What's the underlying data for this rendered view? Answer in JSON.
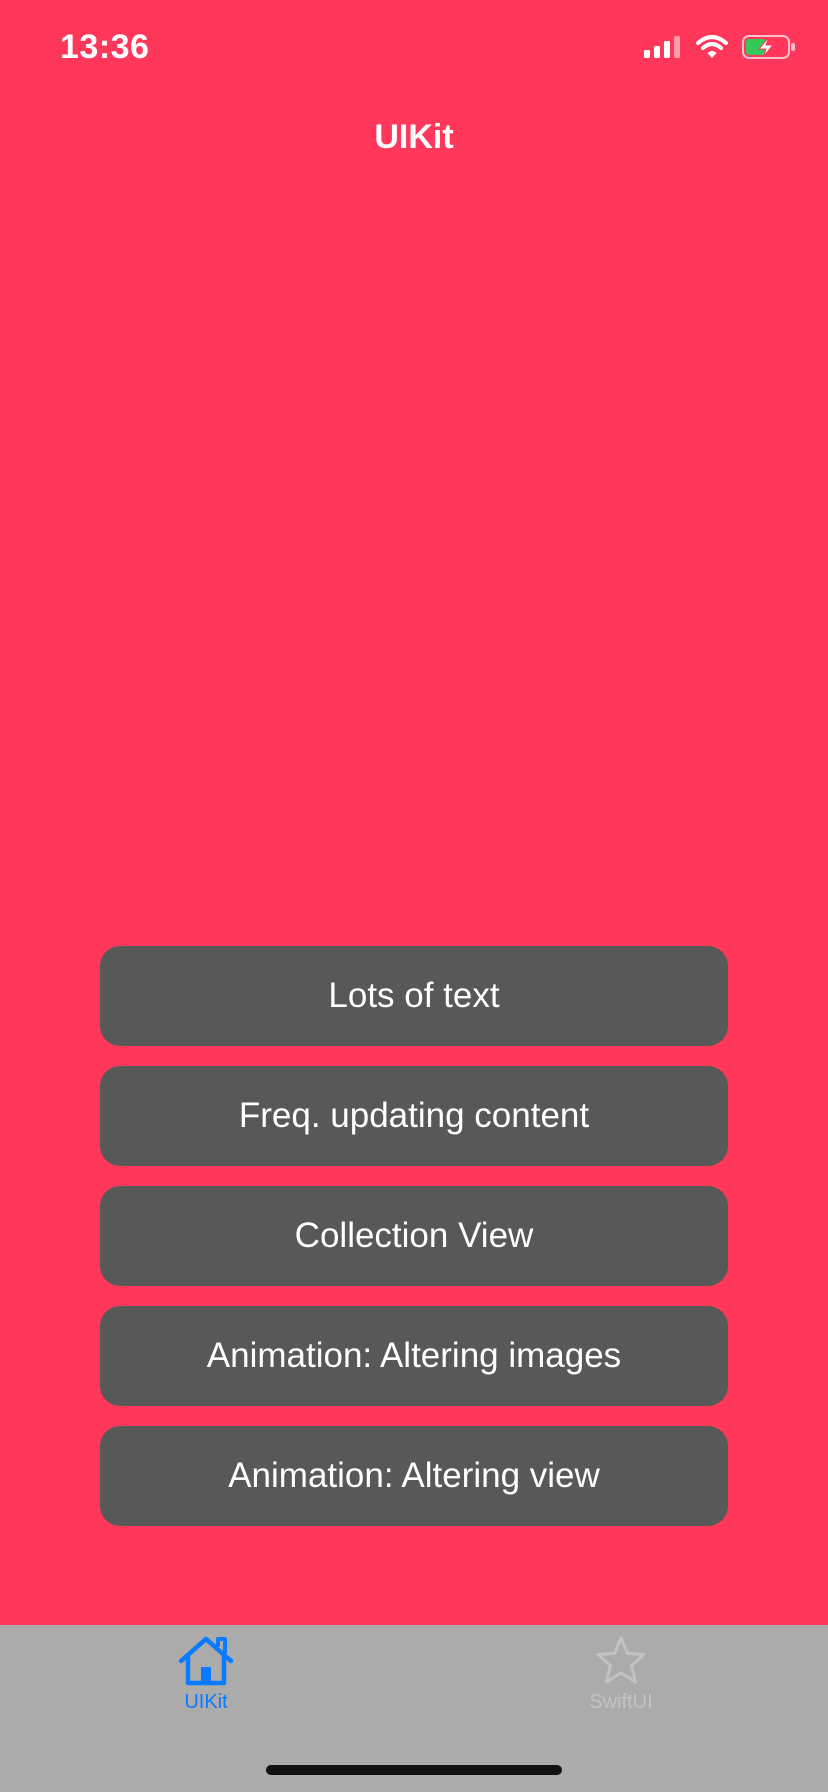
{
  "status_bar": {
    "time": "13:36",
    "icons": [
      "cellular-signal-icon",
      "wifi-icon",
      "battery-charging-icon"
    ]
  },
  "nav": {
    "title": "UIKit"
  },
  "buttons": [
    {
      "label": "Lots of text"
    },
    {
      "label": "Freq. updating content"
    },
    {
      "label": "Collection View"
    },
    {
      "label": "Animation: Altering images"
    },
    {
      "label": "Animation: Altering view"
    }
  ],
  "tab_bar": {
    "tabs": [
      {
        "label": "UIKit",
        "icon": "house-icon",
        "selected": true
      },
      {
        "label": "SwiftUI",
        "icon": "star-icon",
        "selected": false
      }
    ]
  },
  "colors": {
    "background": "#ff375b",
    "button_fill": "#585858",
    "tab_bar_fill": "#ababab",
    "tab_active": "#0a7aff",
    "tab_inactive": "#c2c2c2"
  }
}
